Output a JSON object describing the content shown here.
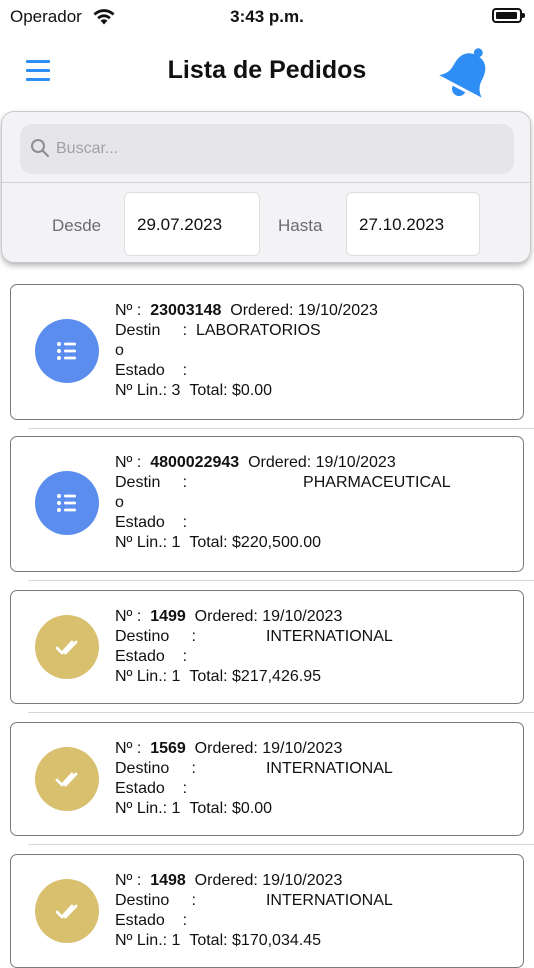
{
  "status_bar": {
    "carrier": "Operador",
    "time": "3:43 p.m."
  },
  "header": {
    "title": "Lista de Pedidos",
    "accent_color": "#2f8ef5"
  },
  "filters": {
    "search_placeholder": "Buscar...",
    "from_label": "Desde",
    "from_value": "29.07.2023",
    "to_label": "Hasta",
    "to_value": "27.10.2023"
  },
  "orders": [
    {
      "number_label": "Nº :",
      "number": "23003148",
      "ordered": "Ordered: 19/10/2023",
      "destination_label": "Destin",
      "destination_colon": ":",
      "destination": "LABORATORIOS",
      "destination_wrap": "o",
      "status_label": "Estado",
      "status_colon": ":",
      "lines": "Nº Lin.: 3",
      "total": "Total: $0.00",
      "status_icon": "list-icon",
      "status_color": "#5b8def"
    },
    {
      "number_label": "Nº :",
      "number": "4800022943",
      "ordered": "Ordered: 19/10/2023",
      "destination_label": "Destin",
      "destination_colon": ":",
      "destination": "PHARMACEUTICAL",
      "destination_wrap": "o",
      "status_label": "Estado",
      "status_colon": ":",
      "lines": "Nº Lin.: 1",
      "total": "Total: $220,500.00",
      "status_icon": "list-icon",
      "status_color": "#5b8def"
    },
    {
      "number_label": "Nº :",
      "number": "1499",
      "ordered": "Ordered: 19/10/2023",
      "destination_label": "Destino",
      "destination_colon": ":",
      "destination": "INTERNATIONAL",
      "status_label": "Estado",
      "status_colon": ":",
      "lines": "Nº Lin.: 1",
      "total": "Total: $217,426.95",
      "status_icon": "double-check-icon",
      "status_color": "#d8c06e"
    },
    {
      "number_label": "Nº :",
      "number": "1569",
      "ordered": "Ordered: 19/10/2023",
      "destination_label": "Destino",
      "destination_colon": ":",
      "destination": "INTERNATIONAL",
      "status_label": "Estado",
      "status_colon": ":",
      "lines": "Nº Lin.: 1",
      "total": "Total: $0.00",
      "status_icon": "double-check-icon",
      "status_color": "#d8c06e"
    },
    {
      "number_label": "Nº :",
      "number": "1498",
      "ordered": "Ordered: 19/10/2023",
      "destination_label": "Destino",
      "destination_colon": ":",
      "destination": "INTERNATIONAL",
      "status_label": "Estado",
      "status_colon": ":",
      "lines": "Nº Lin.: 1",
      "total": "Total: $170,034.45",
      "status_icon": "double-check-icon",
      "status_color": "#d8c06e"
    }
  ]
}
